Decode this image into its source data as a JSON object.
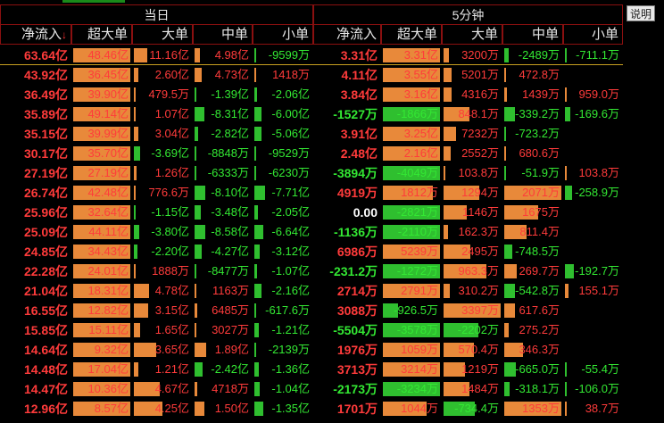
{
  "groups": {
    "daily": "当日",
    "five_min": "5分钟"
  },
  "help_label": "说明",
  "columns": {
    "daily": [
      "净流入",
      "超大单",
      "大单",
      "中单",
      "小单"
    ],
    "five_min": [
      "净流入",
      "超大单",
      "大单",
      "中单",
      "小单"
    ]
  },
  "sort_indicator": "↓",
  "colors": {
    "positive": "#ff3b3b",
    "negative": "#33e833",
    "neutral": "#ffffff",
    "bar_positive": "#e8893a",
    "bar_negative": "#2fbf2f",
    "header_border": "#8a1010"
  },
  "rows": [
    {
      "net": "63.64亿",
      "sd": "48.46亿",
      "dd": "11.16亿",
      "zd": "4.98亿",
      "xd": "-9599万",
      "net5": "3.31亿",
      "sd5": "3.31亿",
      "dd5": "3200万",
      "zd5": "-2489万",
      "xd5": "-711.1万"
    },
    {
      "net": "43.92亿",
      "sd": "36.45亿",
      "dd": "2.60亿",
      "zd": "4.73亿",
      "xd": "1418万",
      "net5": "4.11亿",
      "sd5": "3.55亿",
      "dd5": "5201万",
      "zd5": "472.8万",
      "xd5": ""
    },
    {
      "net": "36.49亿",
      "sd": "39.90亿",
      "dd": "479.5万",
      "zd": "-1.39亿",
      "xd": "-2.06亿",
      "net5": "3.84亿",
      "sd5": "3.16亿",
      "dd5": "4316万",
      "zd5": "1439万",
      "xd5": "959.0万"
    },
    {
      "net": "35.89亿",
      "sd": "49.14亿",
      "dd": "1.07亿",
      "zd": "-8.31亿",
      "xd": "-6.00亿",
      "net5": "-1527万",
      "sd5": "-1866万",
      "dd5": "848.1万",
      "zd5": "-339.2万",
      "xd5": "-169.6万"
    },
    {
      "net": "35.15亿",
      "sd": "39.99亿",
      "dd": "3.04亿",
      "zd": "-2.82亿",
      "xd": "-5.06亿",
      "net5": "3.91亿",
      "sd5": "3.25亿",
      "dd5": "7232万",
      "zd5": "-723.2万",
      "xd5": ""
    },
    {
      "net": "30.17亿",
      "sd": "35.70亿",
      "dd": "-3.69亿",
      "zd": "-8848万",
      "xd": "-9529万",
      "net5": "2.48亿",
      "sd5": "2.16亿",
      "dd5": "2552万",
      "zd5": "680.6万",
      "xd5": ""
    },
    {
      "net": "27.19亿",
      "sd": "27.19亿",
      "dd": "1.26亿",
      "zd": "-6333万",
      "xd": "-6230万",
      "net5": "-3894万",
      "sd5": "-4049万",
      "dd5": "103.8万",
      "zd5": "-51.9万",
      "xd5": "103.8万"
    },
    {
      "net": "26.74亿",
      "sd": "42.48亿",
      "dd": "776.6万",
      "zd": "-8.10亿",
      "xd": "-7.71亿",
      "net5": "4919万",
      "sd5": "1812万",
      "dd5": "1294万",
      "zd5": "2071万",
      "xd5": "-258.9万"
    },
    {
      "net": "25.96亿",
      "sd": "32.64亿",
      "dd": "-1.15亿",
      "zd": "-3.48亿",
      "xd": "-2.05亿",
      "net5": "0.00",
      "sd5": "-2821万",
      "dd5": "1146万",
      "zd5": "1675万",
      "xd5": ""
    },
    {
      "net": "25.09亿",
      "sd": "44.11亿",
      "dd": "-3.80亿",
      "zd": "-8.58亿",
      "xd": "-6.64亿",
      "net5": "-1136万",
      "sd5": "-2110万",
      "dd5": "162.3万",
      "zd5": "811.4万",
      "xd5": ""
    },
    {
      "net": "24.85亿",
      "sd": "34.43亿",
      "dd": "-2.20亿",
      "zd": "-4.27亿",
      "xd": "-3.12亿",
      "net5": "6986万",
      "sd5": "5239万",
      "dd5": "2495万",
      "zd5": "-748.5万",
      "xd5": ""
    },
    {
      "net": "22.28亿",
      "sd": "24.01亿",
      "dd": "1888万",
      "zd": "-8477万",
      "xd": "-1.07亿",
      "net5": "-231.2万",
      "sd5": "-1272万",
      "dd5": "963.3万",
      "zd5": "269.7万",
      "xd5": "-192.7万"
    },
    {
      "net": "21.04亿",
      "sd": "18.31亿",
      "dd": "4.78亿",
      "zd": "1163万",
      "xd": "-2.16亿",
      "net5": "2714万",
      "sd5": "2791万",
      "dd5": "310.2万",
      "zd5": "-542.8万",
      "xd5": "155.1万"
    },
    {
      "net": "16.55亿",
      "sd": "12.82亿",
      "dd": "3.15亿",
      "zd": "6485万",
      "xd": "-617.6万",
      "net5": "3088万",
      "sd5": "-926.5万",
      "dd5": "3397万",
      "zd5": "617.6万",
      "xd5": ""
    },
    {
      "net": "15.85亿",
      "sd": "15.11亿",
      "dd": "1.65亿",
      "zd": "3027万",
      "xd": "-1.21亿",
      "net5": "-5504万",
      "sd5": "-3578万",
      "dd5": "-2202万",
      "zd5": "275.2万",
      "xd5": ""
    },
    {
      "net": "14.64亿",
      "sd": "9.32亿",
      "dd": "3.65亿",
      "zd": "1.89亿",
      "xd": "-2139万",
      "net5": "1976万",
      "sd5": "1059万",
      "dd5": "570.4万",
      "zd5": "346.3万",
      "xd5": ""
    },
    {
      "net": "14.48亿",
      "sd": "17.04亿",
      "dd": "1.21亿",
      "zd": "-2.42亿",
      "xd": "-1.36亿",
      "net5": "3713万",
      "sd5": "3214万",
      "dd5": "1219万",
      "zd5": "-665.0万",
      "xd5": "-55.4万"
    },
    {
      "net": "14.47亿",
      "sd": "10.36亿",
      "dd": "4.67亿",
      "zd": "4718万",
      "xd": "-1.04亿",
      "net5": "-2173万",
      "sd5": "-3234万",
      "dd5": "1484万",
      "zd5": "-318.1万",
      "xd5": "-106.0万"
    },
    {
      "net": "12.96亿",
      "sd": "8.57亿",
      "dd": "4.25亿",
      "zd": "1.50亿",
      "xd": "-1.35亿",
      "net5": "1701万",
      "sd5": "1044万",
      "dd5": "-734.4万",
      "zd5": "1353万",
      "xd5": "38.7万"
    }
  ]
}
